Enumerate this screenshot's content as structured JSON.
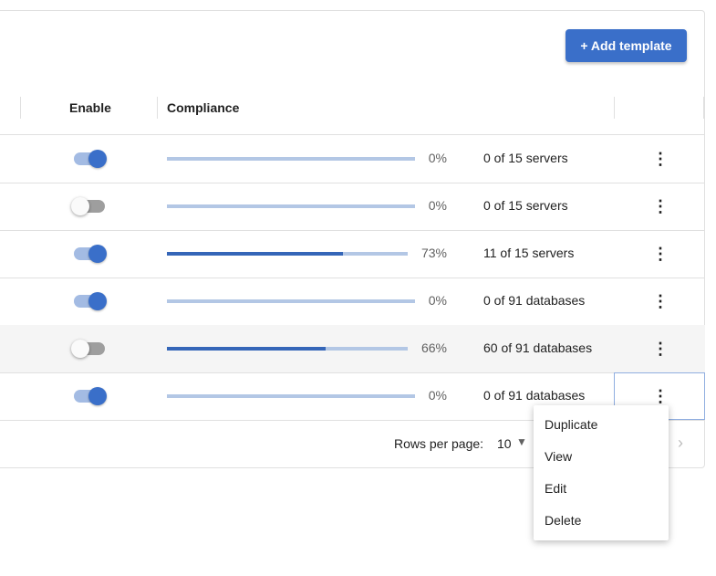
{
  "toolbar": {
    "add_label": "+ Add template"
  },
  "table": {
    "headers": {
      "enable": "Enable",
      "compliance": "Compliance"
    },
    "rows": [
      {
        "enabled": true,
        "progress": 0,
        "percent": "0%",
        "count": "0 of 15 servers"
      },
      {
        "enabled": false,
        "progress": 0,
        "percent": "0%",
        "count": "0 of 15 servers"
      },
      {
        "enabled": true,
        "progress": 73,
        "percent": "73%",
        "count": "11 of 15 servers"
      },
      {
        "enabled": true,
        "progress": 0,
        "percent": "0%",
        "count": "0 of 91 databases"
      },
      {
        "enabled": false,
        "progress": 66,
        "percent": "66%",
        "count": "60 of 91 databases"
      },
      {
        "enabled": true,
        "progress": 0,
        "percent": "0%",
        "count": "0 of 91 databases"
      }
    ],
    "row_actions_icon": "more-vertical-icon"
  },
  "pagination": {
    "rows_per_page_label": "Rows per page:",
    "rows_per_page_value": "10",
    "next_icon": "chevron-right-icon"
  },
  "context_menu": {
    "items": [
      "Duplicate",
      "View",
      "Edit",
      "Delete"
    ]
  },
  "colors": {
    "accent": "#3a6fc9",
    "track_on": "#a3bbe3",
    "track_off": "#9e9e9e",
    "bar_bg": "#b3c7e5",
    "bar_fill": "#3566b8"
  }
}
